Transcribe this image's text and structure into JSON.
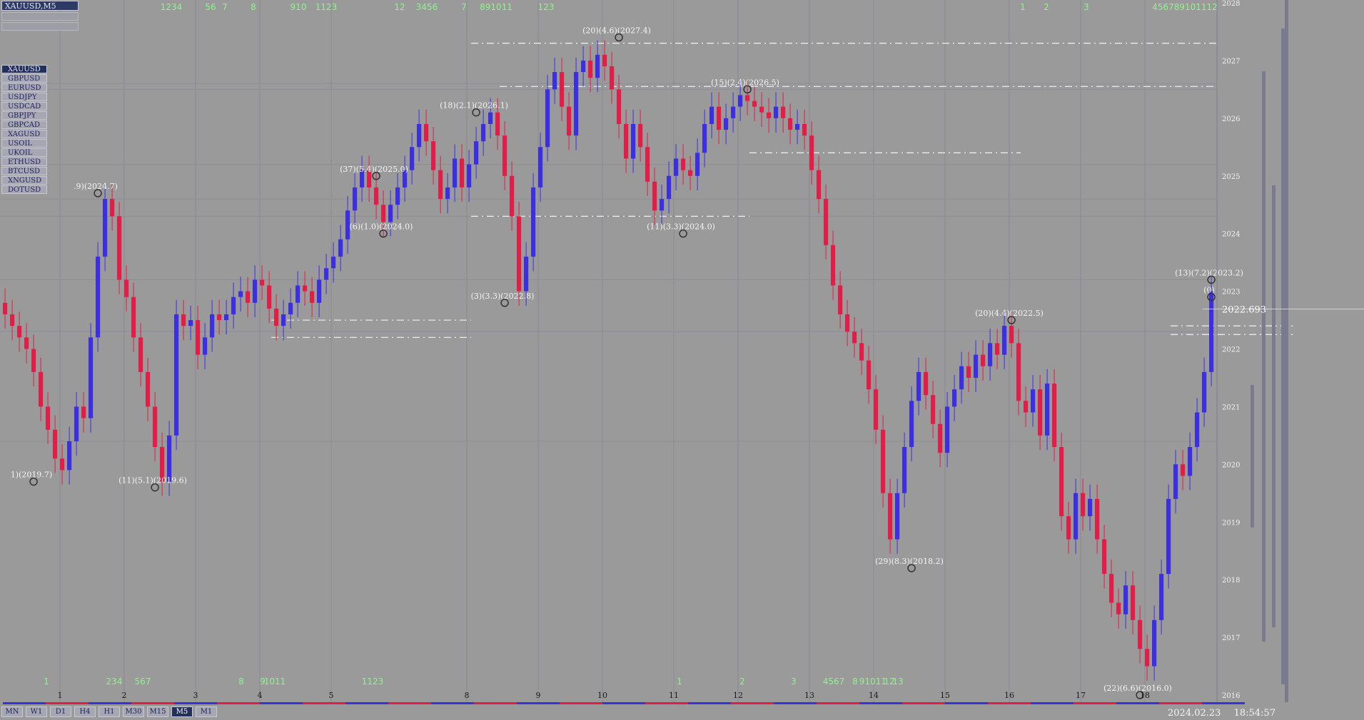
{
  "window_title": "XAUUSD,M5",
  "symbols": [
    {
      "label": "XAUUSD",
      "active": true
    },
    {
      "label": "GBPUSD",
      "active": false
    },
    {
      "label": "EURUSD",
      "active": false
    },
    {
      "label": "USDJPY",
      "active": false
    },
    {
      "label": "USDCAD",
      "active": false
    },
    {
      "label": "GBPJPY",
      "active": false
    },
    {
      "label": "GBPCAD",
      "active": false
    },
    {
      "label": "XAGUSD",
      "active": false
    },
    {
      "label": "USOIL",
      "active": false
    },
    {
      "label": "UKOIL",
      "active": false
    },
    {
      "label": "ETHUSD",
      "active": false
    },
    {
      "label": "BTCUSD",
      "active": false
    },
    {
      "label": "XNGUSD",
      "active": false
    },
    {
      "label": "DOTUSD",
      "active": false
    }
  ],
  "timeframes": [
    {
      "label": "MN",
      "active": false
    },
    {
      "label": "W1",
      "active": false
    },
    {
      "label": "D1",
      "active": false
    },
    {
      "label": "H4",
      "active": false
    },
    {
      "label": "H1",
      "active": false
    },
    {
      "label": "M30",
      "active": false
    },
    {
      "label": "M15",
      "active": false
    },
    {
      "label": "M5",
      "active": true
    },
    {
      "label": "M1",
      "active": false
    }
  ],
  "status": {
    "date": "2024.02.23",
    "time": "18:54:57"
  },
  "colors": {
    "background": "#9a9a9a",
    "bull": "#3b2fe0",
    "bear": "#e01e48",
    "grid": "#8a8a94",
    "yellow": "#f2f200",
    "green": "#8ef58a",
    "white": "#f5f5f5"
  },
  "chart_data": {
    "type": "candlestick",
    "symbol": "XAUUSD",
    "timeframe": "M5",
    "ylim": [
      2016,
      2028
    ],
    "y_ticks": [
      "2028",
      "2027",
      "2026",
      "2025",
      "2024",
      "2023",
      "2022",
      "2021",
      "2020",
      "2019",
      "2018",
      "2017",
      "2016"
    ],
    "x_ticks": [
      {
        "label": "1",
        "i": 8
      },
      {
        "label": "2",
        "i": 17
      },
      {
        "label": "3",
        "i": 27
      },
      {
        "label": "4",
        "i": 36
      },
      {
        "label": "5",
        "i": 46
      },
      {
        "label": "8",
        "i": 65
      },
      {
        "label": "9",
        "i": 75
      },
      {
        "label": "10",
        "i": 84
      },
      {
        "label": "11",
        "i": 94
      },
      {
        "label": "12",
        "i": 103
      },
      {
        "label": "13",
        "i": 113
      },
      {
        "label": "14",
        "i": 122
      },
      {
        "label": "15",
        "i": 132
      },
      {
        "label": "16",
        "i": 141
      },
      {
        "label": "17",
        "i": 151
      },
      {
        "label": "18",
        "i": 160
      }
    ],
    "close": [
      2022.6,
      2022.4,
      2022.2,
      2022.0,
      2021.6,
      2021.0,
      2020.6,
      2020.1,
      2019.9,
      2020.4,
      2021.0,
      2020.8,
      2022.2,
      2023.6,
      2024.6,
      2024.3,
      2023.2,
      2022.9,
      2022.2,
      2021.6,
      2021.0,
      2020.3,
      2019.7,
      2020.5,
      2022.6,
      2022.4,
      2022.5,
      2021.9,
      2022.2,
      2022.6,
      2022.5,
      2022.6,
      2022.9,
      2023.0,
      2022.8,
      2023.2,
      2023.1,
      2022.7,
      2022.4,
      2022.6,
      2022.8,
      2023.1,
      2023.0,
      2022.8,
      2023.2,
      2023.4,
      2023.6,
      2023.9,
      2024.4,
      2024.8,
      2025.1,
      2024.8,
      2024.5,
      2024.2,
      2024.5,
      2024.8,
      2025.1,
      2025.5,
      2025.9,
      2025.6,
      2025.1,
      2024.6,
      2024.8,
      2025.3,
      2024.8,
      2025.2,
      2025.6,
      2025.9,
      2026.1,
      2025.7,
      2025.0,
      2024.3,
      2023.0,
      2023.6,
      2024.8,
      2025.5,
      2026.5,
      2026.8,
      2026.2,
      2025.7,
      2026.8,
      2027.0,
      2026.7,
      2027.1,
      2026.9,
      2026.5,
      2025.9,
      2025.3,
      2025.9,
      2025.5,
      2024.9,
      2024.4,
      2024.6,
      2025.0,
      2025.3,
      2025.1,
      2025.0,
      2025.4,
      2025.9,
      2026.2,
      2025.8,
      2026.0,
      2026.2,
      2026.4,
      2026.3,
      2026.2,
      2026.1,
      2026.0,
      2026.2,
      2026.0,
      2025.8,
      2025.9,
      2025.7,
      2025.1,
      2024.6,
      2023.8,
      2023.1,
      2022.6,
      2022.3,
      2022.1,
      2021.8,
      2021.3,
      2020.6,
      2019.5,
      2018.7,
      2019.5,
      2020.3,
      2021.1,
      2021.6,
      2021.2,
      2020.7,
      2020.2,
      2021.0,
      2021.3,
      2021.7,
      2021.5,
      2021.9,
      2021.7,
      2022.1,
      2021.9,
      2022.4,
      2022.1,
      2021.1,
      2020.9,
      2021.3,
      2020.5,
      2021.4,
      2020.3,
      2019.1,
      2018.7,
      2019.5,
      2019.1,
      2019.4,
      2018.7,
      2018.1,
      2017.6,
      2017.4,
      2017.9,
      2017.3,
      2016.8,
      2016.5,
      2017.3,
      2018.1,
      2019.4,
      2020.0,
      2019.8,
      2020.3,
      2020.9,
      2021.6,
      2023.0
    ],
    "annotations": [
      {
        "i": 4,
        "y": 2019.7,
        "text": "1)(2019.7)"
      },
      {
        "i": 13,
        "y": 2024.7,
        "text": ".9)(2024.7)"
      },
      {
        "i": 21,
        "y": 2019.6,
        "text": "(11)(5.1)(2019.6)"
      },
      {
        "i": 52,
        "y": 2025.0,
        "text": "(37)(5.4)(2025.0)"
      },
      {
        "i": 53,
        "y": 2024.0,
        "text": "(6)(1.0)(2024.0)"
      },
      {
        "i": 66,
        "y": 2026.1,
        "text": "(18)(2.1)(2026.1)"
      },
      {
        "i": 70,
        "y": 2022.8,
        "text": "(3)(3.3)(2022.8)"
      },
      {
        "i": 86,
        "y": 2027.4,
        "text": "(20)(4.6)(2027.4)"
      },
      {
        "i": 95,
        "y": 2024.0,
        "text": "(11)(3.3)(2024.0)"
      },
      {
        "i": 104,
        "y": 2026.5,
        "text": "(15)(2.4)(2026.5)"
      },
      {
        "i": 127,
        "y": 2018.2,
        "text": "(29)(8.3)(2018.2)"
      },
      {
        "i": 141,
        "y": 2022.5,
        "text": "(20)(4.4)(2022.5)"
      },
      {
        "i": 159,
        "y": 2016.0,
        "text": "(22)(6.6)(2016.0)"
      },
      {
        "i": 169,
        "y": 2023.2,
        "text": "(13)(7.2)(2023.2)"
      },
      {
        "i": 169,
        "y": 2022.9,
        "text": "(0)"
      }
    ],
    "current_price": "2022.693",
    "top_counts": [
      "1234",
      "56",
      "7",
      "8",
      "910",
      "1123",
      "12",
      "3456",
      "7",
      "891011",
      "123",
      "1",
      "2",
      "3",
      "456789101112"
    ],
    "bottom_counts": [
      "1",
      "234",
      "567",
      "8",
      "9",
      "1011",
      "1123",
      "1",
      "2",
      "3",
      "4567",
      "8",
      "91011",
      "12",
      "13"
    ]
  }
}
